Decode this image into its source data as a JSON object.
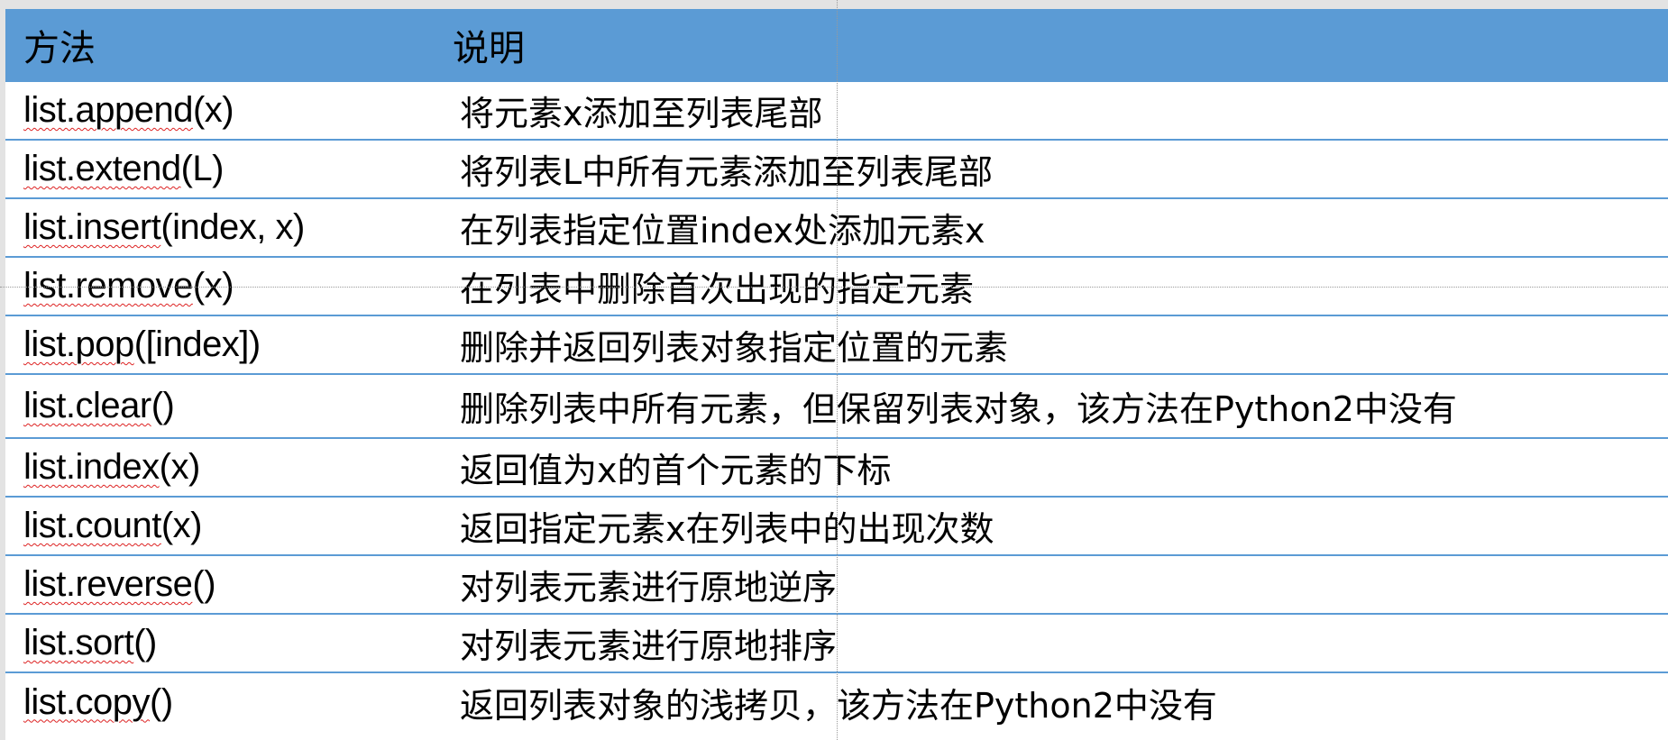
{
  "table": {
    "headers": [
      "方法",
      "说明"
    ],
    "rows": [
      {
        "method_word": "list.append",
        "method_args": "(x)",
        "description": "将元素x添加至列表尾部"
      },
      {
        "method_word": "list.extend",
        "method_args": "(L)",
        "description": "将列表L中所有元素添加至列表尾部"
      },
      {
        "method_word": "list.insert",
        "method_args": "(index, x)",
        "description": "在列表指定位置index处添加元素x"
      },
      {
        "method_word": "list.remove",
        "method_args": "(x)",
        "description": "在列表中删除首次出现的指定元素"
      },
      {
        "method_word": "list.pop",
        "method_args": "([index])",
        "description": "删除并返回列表对象指定位置的元素"
      },
      {
        "method_word": "list.clear",
        "method_args": "()",
        "description": "删除列表中所有元素，但保留列表对象，该方法在Python2中没有"
      },
      {
        "method_word": "list.index",
        "method_args": "(x)",
        "description": "返回值为x的首个元素的下标"
      },
      {
        "method_word": "list.count",
        "method_args": "(x)",
        "description": "返回指定元素x在列表中的出现次数"
      },
      {
        "method_word": "list.reverse",
        "method_args": "()",
        "description": "对列表元素进行原地逆序"
      },
      {
        "method_word": "list.sort",
        "method_args": "()",
        "description": "对列表元素进行原地排序"
      },
      {
        "method_word": "list.copy",
        "method_args": "()",
        "description": "返回列表对象的浅拷贝，该方法在Python2中没有"
      }
    ]
  },
  "colors": {
    "header_bg": "#5b9bd5",
    "row_border": "#5b9bd5",
    "page_bg": "#e3e3e3",
    "cell_bg": "#ffffff",
    "spellcheck": "#dd2222"
  }
}
